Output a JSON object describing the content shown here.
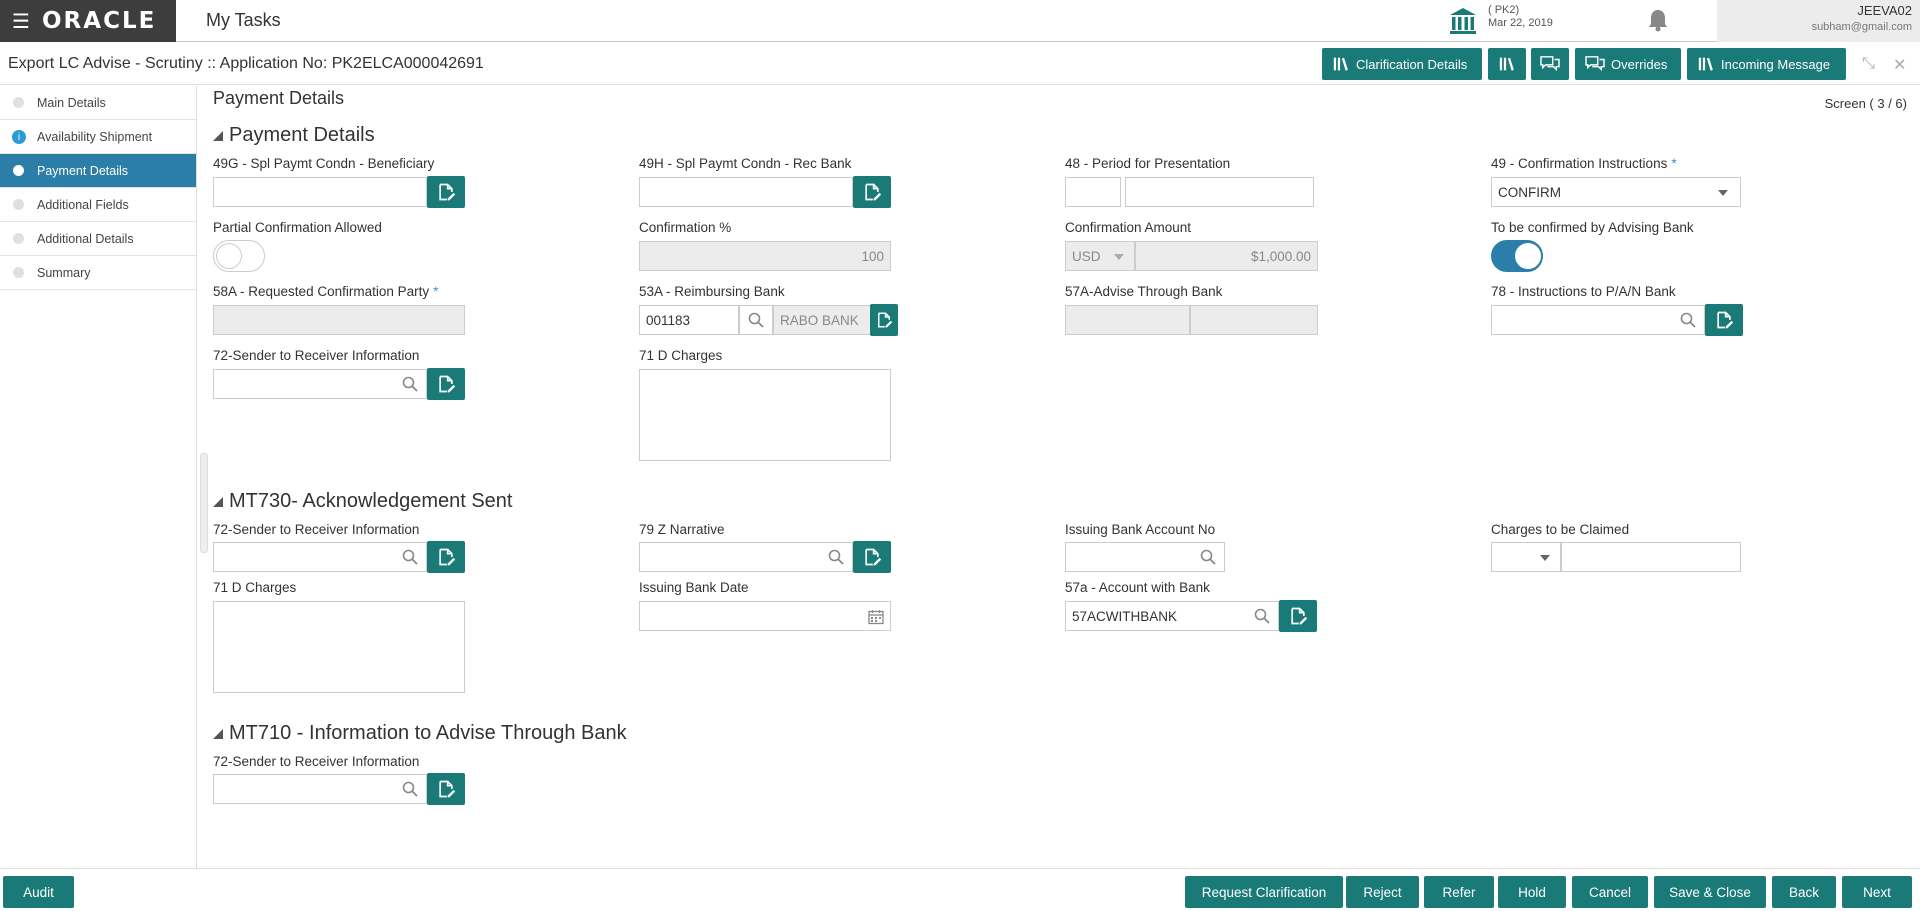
{
  "header": {
    "logo": "ORACLE",
    "title": "My Tasks",
    "branch_code": "( PK2)",
    "branch_date": "Mar 22, 2019",
    "user_name": "JEEVA02",
    "user_email": "subham@gmail.com"
  },
  "subheader": {
    "app_title": "Export LC Advise - Scrutiny :: Application No: PK2ELCA000042691",
    "buttons": {
      "clarification": "Clarification Details",
      "overrides": "Overrides",
      "incoming": "Incoming Message"
    }
  },
  "sidebar": {
    "items": [
      {
        "label": "Main Details"
      },
      {
        "label": "Availability Shipment"
      },
      {
        "label": "Payment Details"
      },
      {
        "label": "Additional Fields"
      },
      {
        "label": "Additional Details"
      },
      {
        "label": "Summary"
      }
    ],
    "active_index": 2
  },
  "page": {
    "title": "Payment Details",
    "screen_count": "Screen ( 3 / 6)"
  },
  "payment_section": {
    "title": "Payment Details",
    "labels": {
      "spl_bene": "49G - Spl Paymt Condn - Beneficiary",
      "spl_rec": "49H - Spl Paymt Condn - Rec Bank",
      "period": "48 - Period for Presentation",
      "conf_instr": "49 - Confirmation Instructions",
      "partial_conf": "Partial Confirmation Allowed",
      "conf_pct": "Confirmation %",
      "conf_amt": "Confirmation Amount",
      "to_be_confirmed": "To be confirmed by Advising Bank",
      "req_conf_party": "58A - Requested Confirmation Party",
      "reimb_bank": "53A - Reimbursing Bank",
      "advise_through": "57A-Advise Through Bank",
      "instr_pan": "78 - Instructions to P/A/N Bank",
      "sender_info": "72-Sender to Receiver Information",
      "charges": "71 D Charges"
    },
    "values": {
      "conf_instr": "CONFIRM",
      "conf_pct": "100",
      "conf_currency": "USD",
      "conf_amt": "$1,000.00",
      "reimb_code": "001183",
      "reimb_name": "RABO BANK"
    },
    "toggles": {
      "partial_conf": false,
      "to_be_confirmed": true
    }
  },
  "mt730_section": {
    "title": "MT730- Acknowledgement Sent",
    "labels": {
      "sender_info": "72-Sender to Receiver Information",
      "narrative": "79 Z Narrative",
      "issuing_acct": "Issuing Bank Account No",
      "charges_claimed": "Charges to be Claimed",
      "charges": "71 D Charges",
      "issuing_date": "Issuing Bank Date",
      "account_with": "57a - Account with Bank"
    },
    "values": {
      "account_with": "57ACWITHBANK"
    }
  },
  "mt710_section": {
    "title": "MT710 - Information to Advise Through Bank",
    "labels": {
      "sender_info": "72-Sender to Receiver Information"
    }
  },
  "footer": {
    "audit": "Audit",
    "request_clarification": "Request Clarification",
    "reject": "Reject",
    "refer": "Refer",
    "hold": "Hold",
    "cancel": "Cancel",
    "save_close": "Save & Close",
    "back": "Back",
    "next": "Next"
  },
  "colors": {
    "accent": "#1a7a78",
    "active_nav": "#2a7ea8",
    "required": "#2a9bd6"
  }
}
